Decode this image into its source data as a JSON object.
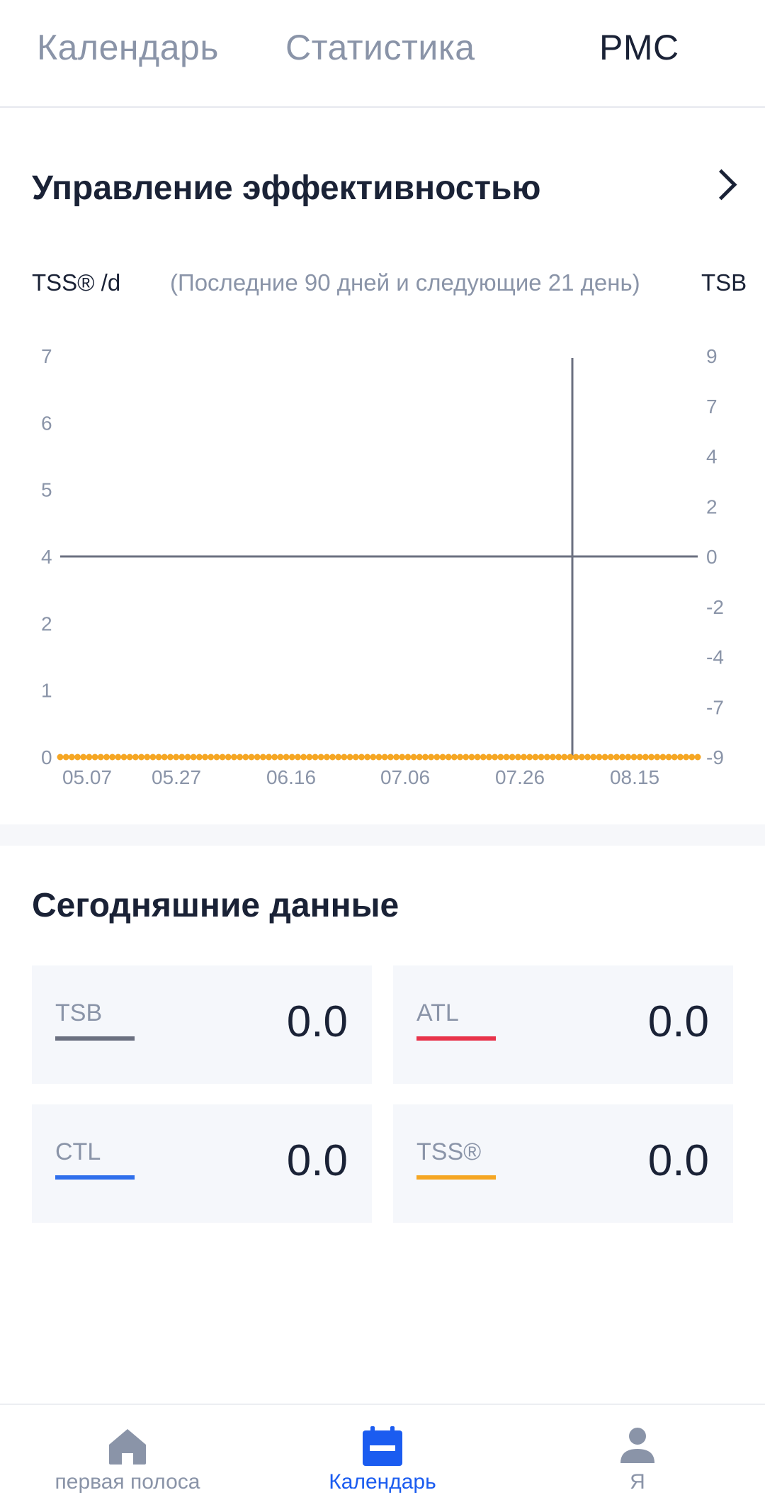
{
  "tabs": [
    {
      "label": "Календарь",
      "active": false
    },
    {
      "label": "Статистика",
      "active": false
    },
    {
      "label": "PMC",
      "active": true
    }
  ],
  "performance": {
    "title": "Управление эффективностью",
    "left_axis_label": "TSS® /d",
    "subtitle": "(Последние 90 дней и следующие 21 день)",
    "right_axis_label": "TSB"
  },
  "chart_data": {
    "type": "line",
    "title": "Управление эффективностью",
    "subtitle": "(Последние 90 дней и следующие 21 день)",
    "ylabel": "TSS® /d",
    "y2label": "TSB",
    "x_ticks": [
      "05.07",
      "05.27",
      "06.16",
      "07.06",
      "07.26",
      "08.15"
    ],
    "y_left_ticks": [
      "0",
      "1",
      "2",
      "4",
      "5",
      "6",
      "7"
    ],
    "y_right_ticks": [
      "-9",
      "-7",
      "-4",
      "-2",
      "0",
      "2",
      "4",
      "7",
      "9"
    ],
    "ylim": [
      0,
      7
    ],
    "y2lim": [
      -9,
      9
    ],
    "series": [
      {
        "name": "TSS®",
        "axis": "left",
        "color": "#f5a623",
        "style": "dots",
        "constant_value": 0,
        "point_count": 111
      },
      {
        "name": "TSB",
        "axis": "right",
        "color": "#6b7080",
        "style": "line",
        "constant_value": 0
      }
    ],
    "today_marker": "08.05",
    "grid": false
  },
  "today": {
    "title": "Сегодняшние данные",
    "cards": [
      {
        "label": "TSB",
        "value": "0.0",
        "color": "#6b7080"
      },
      {
        "label": "ATL",
        "value": "0.0",
        "color": "#e8334a"
      },
      {
        "label": "CTL",
        "value": "0.0",
        "color": "#2f6fec"
      },
      {
        "label": "TSS®",
        "value": "0.0",
        "color": "#f5a623"
      }
    ]
  },
  "nav": [
    {
      "label": "первая полоса",
      "icon": "home-icon",
      "active": false
    },
    {
      "label": "Календарь",
      "icon": "calendar-icon",
      "active": true
    },
    {
      "label": "Я",
      "icon": "user-icon",
      "active": false
    }
  ]
}
